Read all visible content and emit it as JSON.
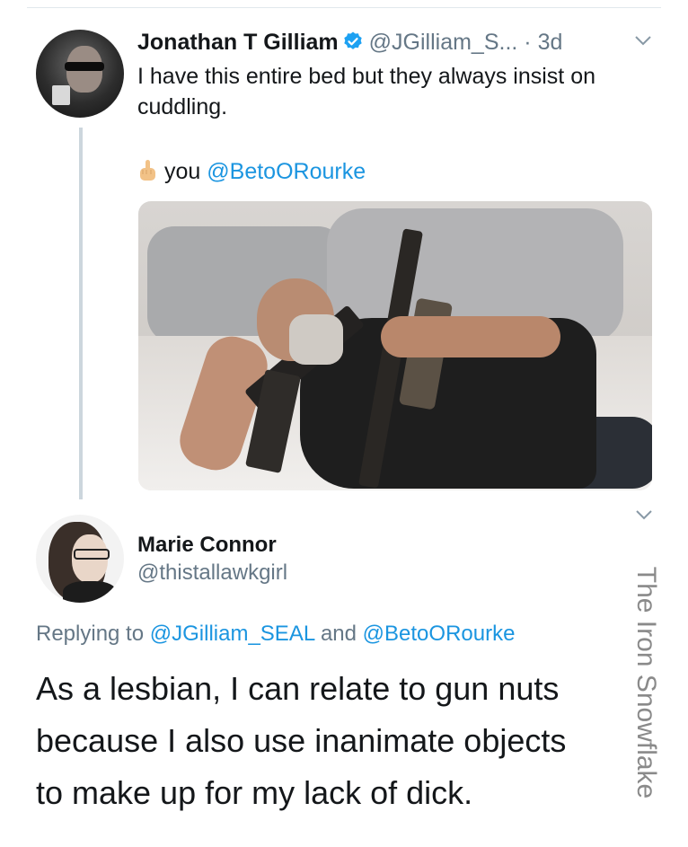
{
  "tweet1": {
    "author_name": "Jonathan T Gilliam",
    "handle": "@JGilliam_S...",
    "time": "· 3d",
    "text": "I have this entire bed but they always insist on cuddling.",
    "line2_text": "you",
    "line2_mention": "@BetoORourke"
  },
  "tweet2": {
    "author_name": "Marie Connor",
    "handle": "@thistallawkgirl",
    "replying_prefix": "Replying to",
    "replying_mention1": "@JGilliam_SEAL",
    "replying_and": "and",
    "replying_mention2": "@BetoORourke",
    "text_lines": [
      "As a lesbian, I can relate to gun nuts",
      "because I also use inanimate objects",
      "to make up for my lack of dick."
    ]
  },
  "watermark": "The Iron Snowflake",
  "colors": {
    "link": "#1b95e0",
    "secondary_text": "#657786",
    "verified": "#1da1f2",
    "thread_line": "#ccd6dd"
  },
  "icons": [
    "verified-badge-icon",
    "chevron-down-icon",
    "middle-finger-emoji-icon"
  ]
}
